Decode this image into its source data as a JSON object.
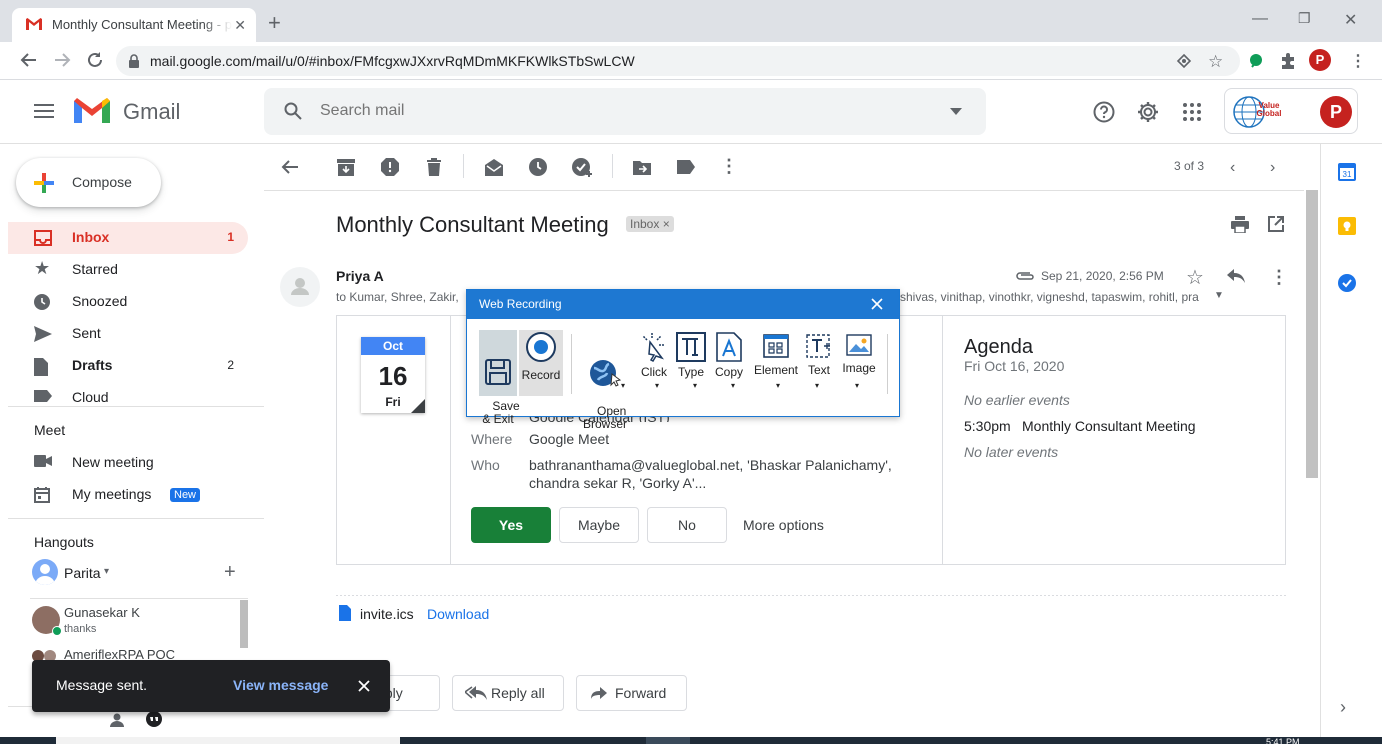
{
  "browser": {
    "tab_title": "Monthly Consultant Meeting - pa",
    "url": "mail.google.com/mail/u/0/#inbox/FMfcgxwJXxrvRqMDmMKFKWlkSTbSwLCW",
    "profile_initial": "P"
  },
  "gmail": {
    "brand": "Gmail",
    "search_placeholder": "Search mail",
    "account_initial": "P",
    "org_logo_text": "Value Global"
  },
  "sidebar": {
    "compose": "Compose",
    "items": [
      {
        "label": "Inbox",
        "count": "1"
      },
      {
        "label": "Starred",
        "count": ""
      },
      {
        "label": "Snoozed",
        "count": ""
      },
      {
        "label": "Sent",
        "count": ""
      },
      {
        "label": "Drafts",
        "count": "2"
      },
      {
        "label": "Cloud",
        "count": ""
      }
    ],
    "meet_title": "Meet",
    "new_meeting": "New meeting",
    "my_meetings": "My meetings",
    "new_badge": "New",
    "hangouts_title": "Hangouts",
    "hangouts_user": "Parita",
    "contacts": [
      {
        "name": "Gunasekar K",
        "status": "thanks"
      },
      {
        "name": "AmeriflexRPA POC",
        "status": ""
      }
    ]
  },
  "toolbar": {
    "pagination": "3 of 3"
  },
  "message": {
    "subject": "Monthly Consultant Meeting",
    "label": "Inbox",
    "sender": "Priya A",
    "to_left": "to Kumar, Shree, Zakir,",
    "to_right": "shivas, vinithap, vinothkr, vigneshd, tapaswim, rohitl, pra",
    "date": "Sep 21, 2020, 2:56 PM"
  },
  "invite": {
    "month": "Oct",
    "day": "16",
    "weekday": "Fri",
    "calendar_line": "Google Calendar (IST)",
    "where_label": "Where",
    "where_value": "Google Meet",
    "who_label": "Who",
    "who_value_1": "bathrananthama@valueglobal.net, 'Bhaskar Palanichamy',",
    "who_value_2": "chandra sekar R, 'Gorky A'...",
    "yes": "Yes",
    "maybe": "Maybe",
    "no": "No",
    "more_options": "More options",
    "agenda_title": "Agenda",
    "agenda_date": "Fri Oct 16, 2020",
    "no_earlier": "No earlier events",
    "event_time": "5:30pm",
    "event_title": "Monthly Consultant Meeting",
    "no_later": "No later events"
  },
  "attachment": {
    "name": "invite.ics",
    "download": "Download"
  },
  "reply": {
    "reply": "Reply",
    "reply_all": "Reply all",
    "forward": "Forward"
  },
  "toast": {
    "text": "Message sent.",
    "action": "View message"
  },
  "recorder": {
    "title": "Web Recording",
    "buttons": [
      {
        "label": "Save\n& Exit"
      },
      {
        "label": "Record"
      },
      {
        "label": "Open\nBrowser"
      },
      {
        "label": "Click"
      },
      {
        "label": "Type"
      },
      {
        "label": "Copy"
      },
      {
        "label": "Element"
      },
      {
        "label": "Text"
      },
      {
        "label": "Image"
      }
    ]
  },
  "taskbar": {
    "time": "5:41 PM"
  }
}
